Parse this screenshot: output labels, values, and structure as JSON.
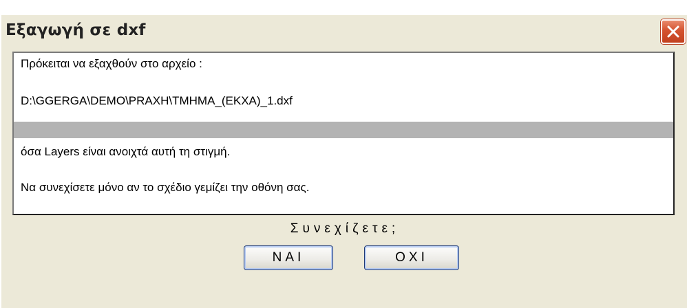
{
  "window": {
    "title": "Εξαγωγή σε dxf"
  },
  "message": {
    "line1": "Πρόκειται να εξαχθούν στο αρχείο :",
    "line2": "D:\\GGERGA\\DEMO\\PRAXH\\TMHMA_(EKXA)_1.dxf",
    "line3": "",
    "line4": "όσα Layers είναι ανοιχτά αυτή τη στιγμή.",
    "line5": "Να συνεχίσετε μόνο αν το σχέδιο γεμίζει την οθόνη σας."
  },
  "prompt": "Συνεχίζετε;",
  "buttons": {
    "yes_label": "NAI",
    "no_label": "OXI"
  },
  "icons": {
    "close": "close-icon"
  },
  "colors": {
    "window_bg": "#ece9d8",
    "close_red": "#d4522f",
    "selection_gray": "#b3b3b3",
    "button_border": "#1f3a76"
  }
}
